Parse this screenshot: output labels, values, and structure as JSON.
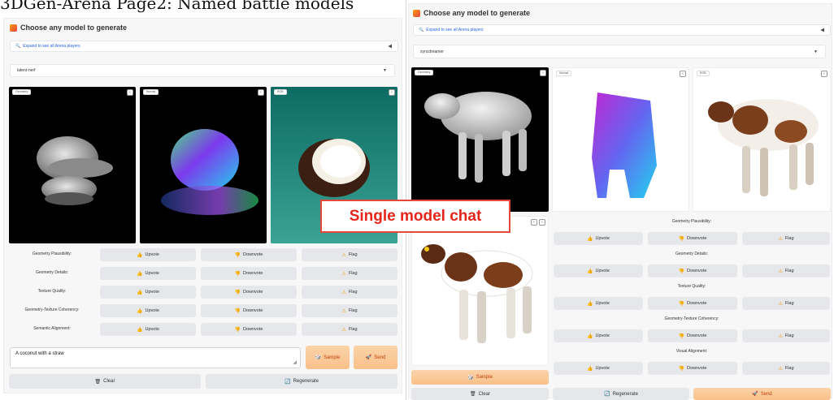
{
  "header": {
    "title": "3DGen-Arena Page2: Named battle models"
  },
  "left": {
    "choose_label": "Choose any model to generate",
    "expand_label": "Expand to see all Arena players",
    "model_value": "latent-nerf",
    "image_labels": [
      "Geometry",
      "Normal",
      "RGB"
    ],
    "rows": [
      {
        "label": "Geometry Plausibility:"
      },
      {
        "label": "Geometry Details:"
      },
      {
        "label": "Texture Quality:"
      },
      {
        "label": "Geometry-Texture Coherency:"
      },
      {
        "label": "Semantic Alignment:"
      }
    ],
    "upvote": "Upvote",
    "downvote": "Downvote",
    "flag": "Flag",
    "prompt_value": "A coconut with a straw",
    "sample": "Sample",
    "send": "Send",
    "clear": "Clear",
    "regenerate": "Regenerate"
  },
  "right": {
    "choose_label": "Choose any model to generate",
    "expand_label": "Expand to see all Arena players",
    "model_value": "syncdreamer",
    "image_labels": [
      "Geometry",
      "Normal",
      "RGB"
    ],
    "rows": [
      {
        "label": "Geometry Plausibility:"
      },
      {
        "label": "Geometry Details:"
      },
      {
        "label": "Texture Quality:"
      },
      {
        "label": "Geometry-Texture Coherency:"
      },
      {
        "label": "Visual Alignment:"
      }
    ],
    "upvote": "Upvote",
    "downvote": "Downvote",
    "flag": "Flag",
    "sample": "Sample",
    "clear": "Clear",
    "regenerate": "Regenerate",
    "send": "Send"
  },
  "overlay": {
    "text": "Single model chat"
  },
  "colors": {
    "accent_orange": "#f9c08a",
    "overlay_red": "#e5251b",
    "button_gray": "#e5e7eb"
  },
  "icons": {
    "upvote": "thumbs-up-icon",
    "downvote": "thumbs-down-icon",
    "flag": "warning-icon",
    "clear": "trash-icon",
    "regenerate": "refresh-icon",
    "send": "send-icon",
    "sample": "dice-icon"
  }
}
